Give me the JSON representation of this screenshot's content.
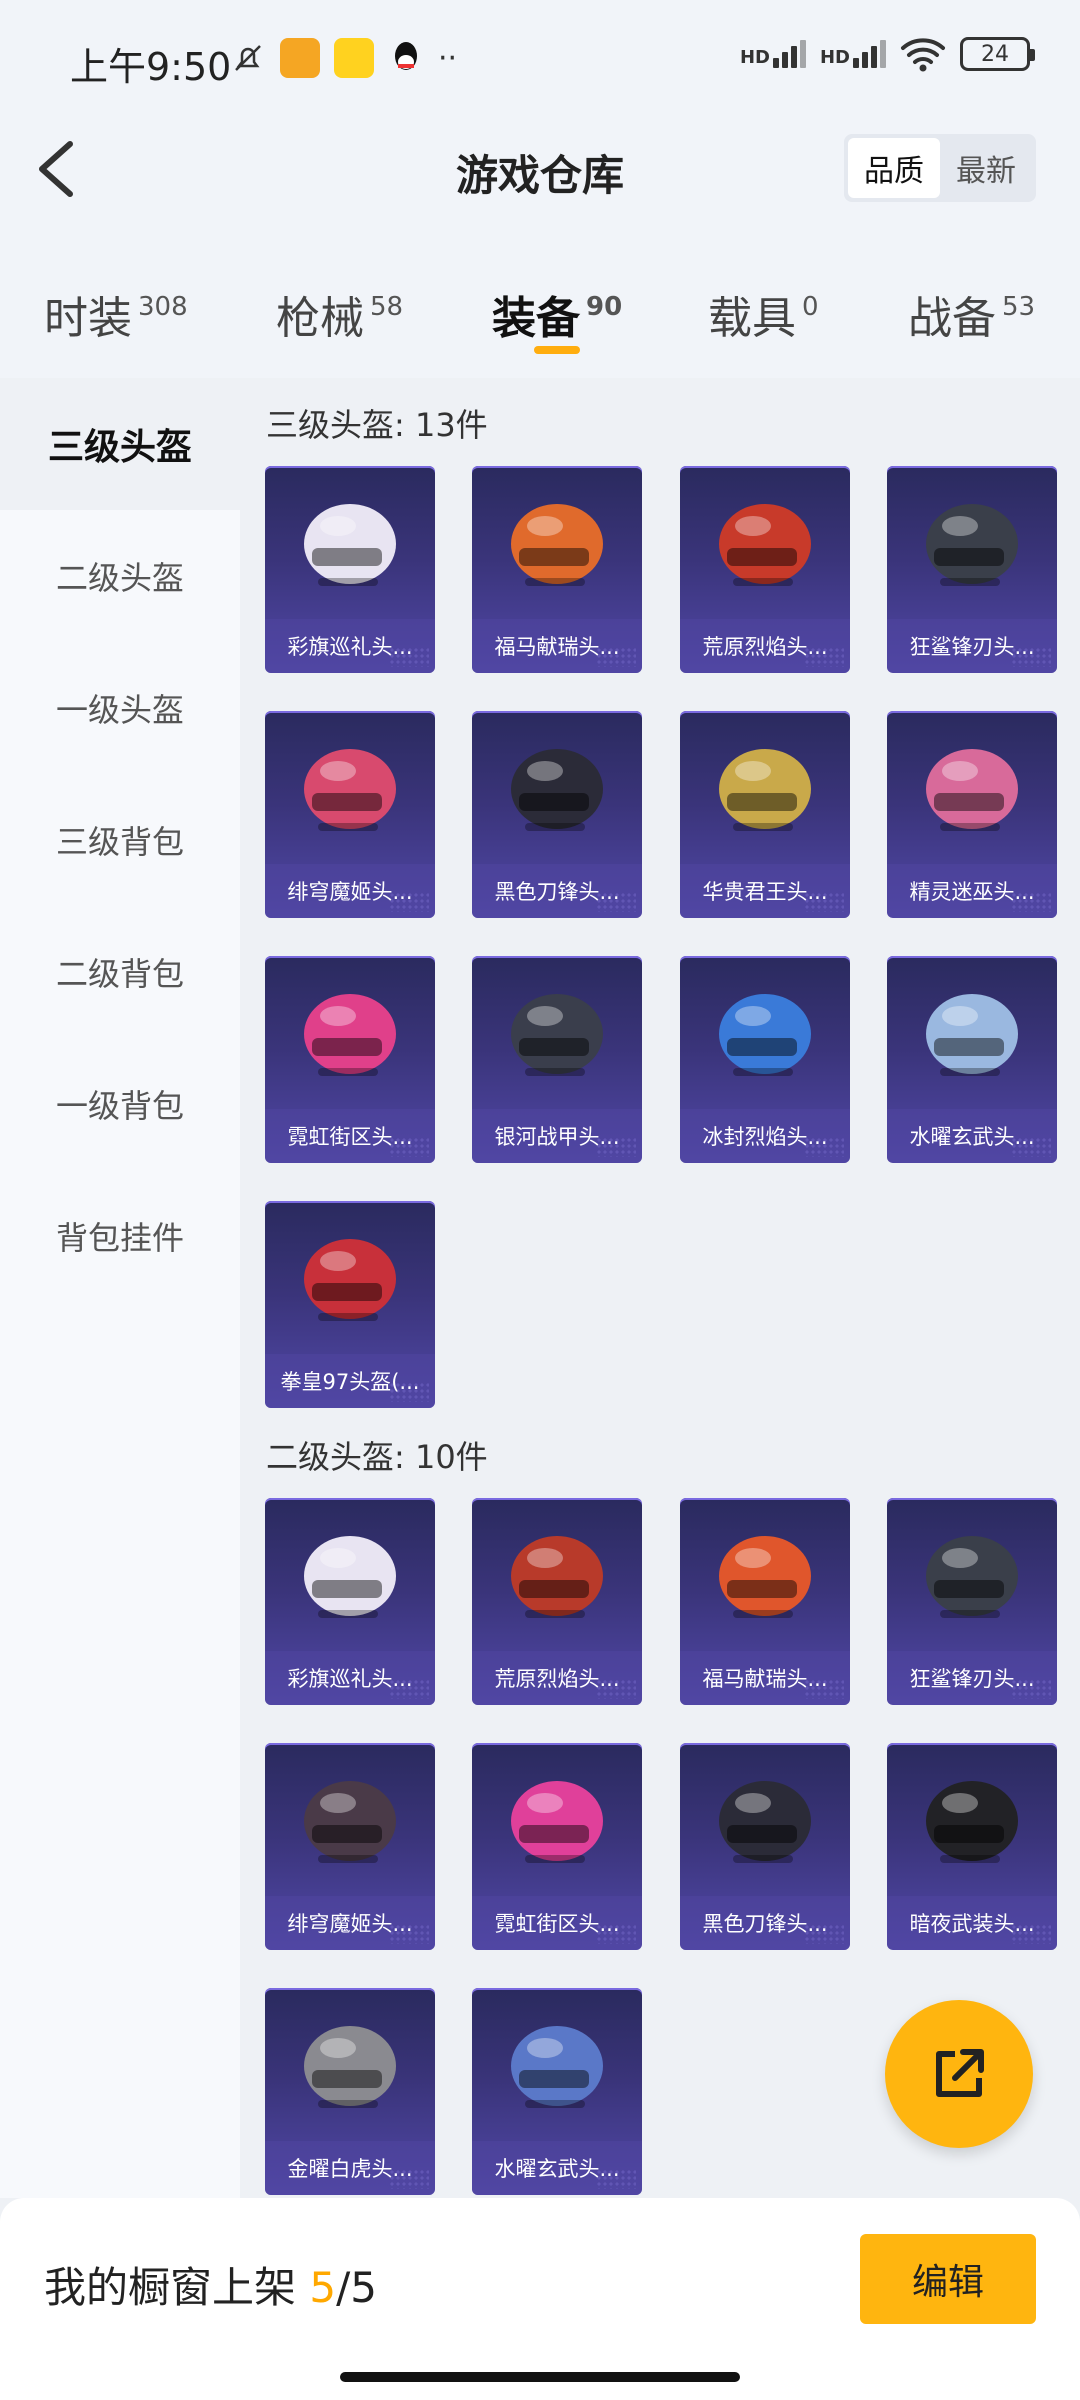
{
  "status": {
    "time": "上午9:50",
    "signal1": "HD",
    "signal2": "HD",
    "battery": "24"
  },
  "header": {
    "title": "游戏仓库",
    "sort_options": [
      "品质",
      "最新"
    ]
  },
  "tabs": [
    {
      "label": "时装",
      "count": "308"
    },
    {
      "label": "枪械",
      "count": "58"
    },
    {
      "label": "装备",
      "count": "90"
    },
    {
      "label": "载具",
      "count": "0"
    },
    {
      "label": "战备",
      "count": "53"
    }
  ],
  "sidebar": [
    "三级头盔",
    "二级头盔",
    "一级头盔",
    "三级背包",
    "二级背包",
    "一级背包",
    "背包挂件"
  ],
  "sections": [
    {
      "title": "三级头盔: 13件",
      "items": [
        {
          "name": "彩旗巡礼头...",
          "color": "#e8e4f2"
        },
        {
          "name": "福马献瑞头...",
          "color": "#e06a2c"
        },
        {
          "name": "荒原烈焰头...",
          "color": "#c83a2a"
        },
        {
          "name": "狂鲨锋刃头...",
          "color": "#3a3f4a"
        },
        {
          "name": "绯穹魔姬头...",
          "color": "#d84a6e"
        },
        {
          "name": "黑色刀锋头...",
          "color": "#2b2b38"
        },
        {
          "name": "华贵君王头...",
          "color": "#c9a94a"
        },
        {
          "name": "精灵迷巫头...",
          "color": "#d86a9a"
        },
        {
          "name": "霓虹街区头...",
          "color": "#e0408a"
        },
        {
          "name": "银河战甲头...",
          "color": "#3a3e4c"
        },
        {
          "name": "冰封烈焰头...",
          "color": "#3a7ad8"
        },
        {
          "name": "水曜玄武头...",
          "color": "#9ab8e0"
        },
        {
          "name": "拳皇97头盔(...",
          "color": "#c8303a"
        }
      ]
    },
    {
      "title": "二级头盔: 10件",
      "items": [
        {
          "name": "彩旗巡礼头...",
          "color": "#e8e4f2"
        },
        {
          "name": "荒原烈焰头...",
          "color": "#b83a2a"
        },
        {
          "name": "福马献瑞头...",
          "color": "#e0562c"
        },
        {
          "name": "狂鲨锋刃头...",
          "color": "#3a3f4a"
        },
        {
          "name": "绯穹魔姬头...",
          "color": "#4a3a48"
        },
        {
          "name": "霓虹街区头...",
          "color": "#e0409a"
        },
        {
          "name": "黑色刀锋头...",
          "color": "#2b2b38"
        },
        {
          "name": "暗夜武装头...",
          "color": "#222226"
        },
        {
          "name": "金曜白虎头...",
          "color": "#8a8a90"
        },
        {
          "name": "水曜玄武头...",
          "color": "#5a78c8"
        }
      ]
    }
  ],
  "bottom": {
    "showcase_label": "我的橱窗上架",
    "showcase_current": "5",
    "showcase_total": "/5",
    "edit_label": "编辑"
  }
}
